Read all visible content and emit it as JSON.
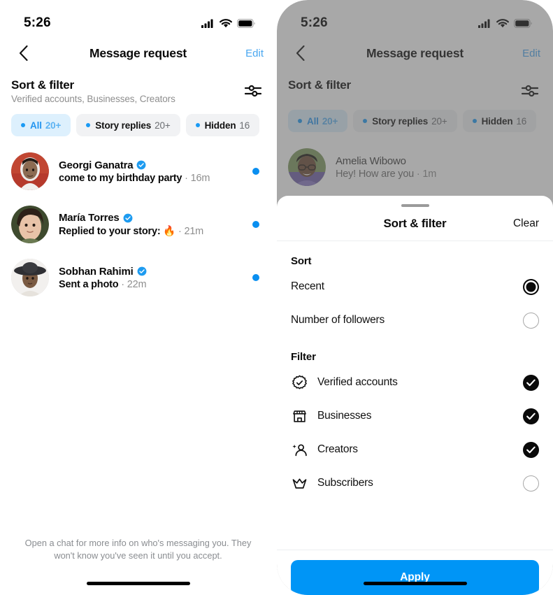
{
  "status_bar": {
    "time": "5:26",
    "signal_icon": "cellular-signal-icon",
    "wifi_icon": "wifi-icon",
    "battery_icon": "battery-icon"
  },
  "nav": {
    "back_icon": "chevron-left-icon",
    "title": "Message request",
    "edit_label": "Edit"
  },
  "sort_filter_header": {
    "title": "Sort & filter",
    "subtitle": "Verified accounts, Businesses, Creators",
    "icon": "sliders-icon"
  },
  "chips": [
    {
      "label": "All",
      "count": "20+",
      "active": true
    },
    {
      "label": "Story replies",
      "count": "20+",
      "active": false
    },
    {
      "label": "Hidden",
      "count": "16",
      "active": false
    }
  ],
  "messages": [
    {
      "name": "Georgi Ganatra",
      "verified": true,
      "preview": "come to my birthday party",
      "time": "16m",
      "unread": true
    },
    {
      "name": "María Torres",
      "verified": true,
      "preview": "Replied to your story: 🔥",
      "time": "21m",
      "unread": true
    },
    {
      "name": "Sobhan Rahimi",
      "verified": true,
      "preview": "Sent a photo",
      "time": "22m",
      "unread": true
    }
  ],
  "messages_right": [
    {
      "name": "Amelia Wibowo",
      "verified": false,
      "preview": "Hey! How are you",
      "time": "1m",
      "unread": false
    }
  ],
  "footer_note": "Open a chat for more info on who's messaging you. They won't know you've seen it until you accept.",
  "sheet": {
    "grab_handle": "drag-handle",
    "title": "Sort & filter",
    "clear_label": "Clear",
    "sort_section_title": "Sort",
    "sort_options": [
      {
        "label": "Recent",
        "selected": true
      },
      {
        "label": "Number of followers",
        "selected": false
      }
    ],
    "filter_section_title": "Filter",
    "filter_options": [
      {
        "label": "Verified accounts",
        "icon": "verified-badge-icon",
        "checked": true
      },
      {
        "label": "Businesses",
        "icon": "storefront-icon",
        "checked": true
      },
      {
        "label": "Creators",
        "icon": "person-star-icon",
        "checked": true
      },
      {
        "label": "Subscribers",
        "icon": "crown-icon",
        "checked": false
      }
    ],
    "apply_label": "Apply"
  },
  "colors": {
    "accent_blue": "#0095f6",
    "link_blue": "#4aa7f0",
    "chip_active_bg": "#ddf0fd",
    "chip_bg": "#f1f2f4",
    "unread_dot": "#0a8ff0",
    "muted_text": "#8e8e8e"
  }
}
